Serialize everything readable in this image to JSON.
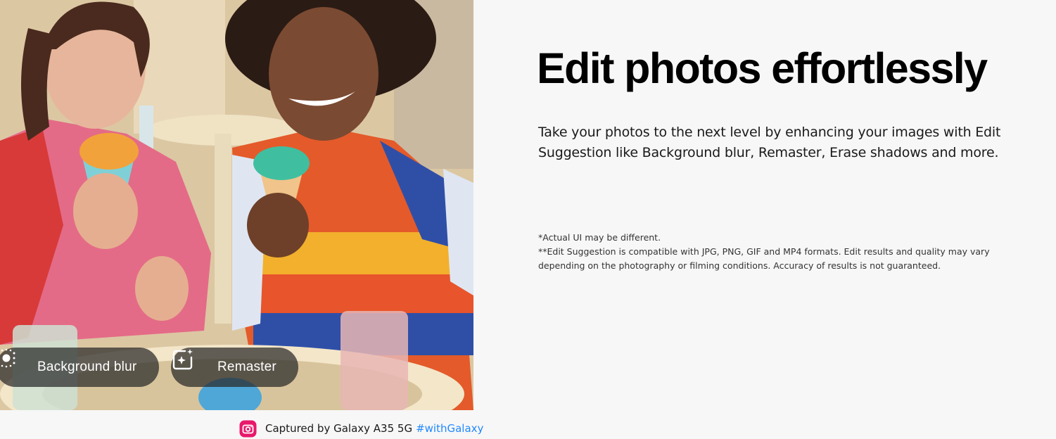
{
  "photo": {
    "chips": {
      "background_blur": {
        "label": "Background blur",
        "icon": "background-blur-icon"
      },
      "remaster": {
        "label": "Remaster",
        "icon": "remaster-sparkle-icon"
      }
    },
    "caption": {
      "icon": "camera-app-icon",
      "text": "Captured by Galaxy A35 5G",
      "hashtag": "#withGalaxy",
      "icon_color": "#e8186b",
      "hashtag_color": "#2189ff"
    }
  },
  "content": {
    "heading": "Edit photos effortlessly",
    "description": "Take your photos to the next level by enhancing your images with Edit Suggestion like Background blur, Remaster, Erase shadows and more.",
    "disclaimers": [
      "*Actual UI may be different.",
      "**Edit Suggestion is compatible with JPG, PNG, GIF and MP4 formats. Edit results and quality may vary depending on the photography or filming conditions. Accuracy of results is not guaranteed."
    ]
  }
}
